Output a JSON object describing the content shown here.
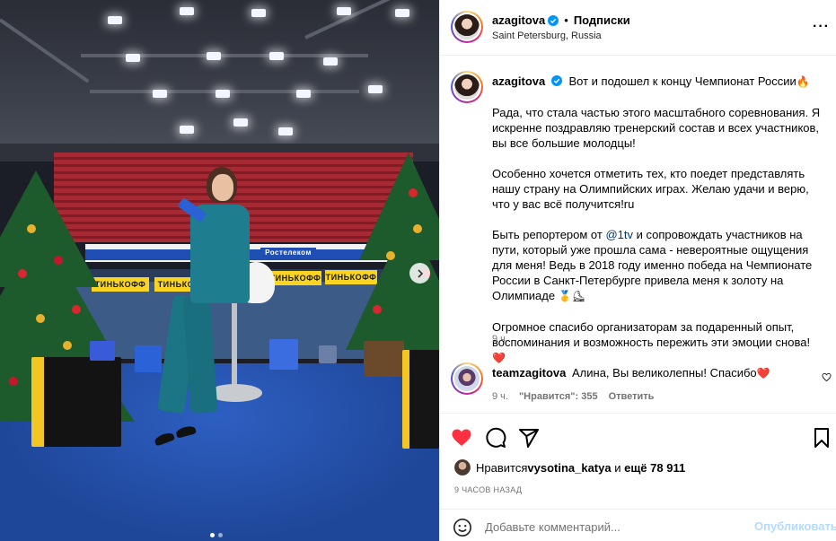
{
  "post": {
    "author": "azagitova",
    "verified": true,
    "follow_label": "Подписки",
    "location": "Saint Petersburg, Russia",
    "more_icon": "more-horizontal-icon",
    "media_pages": 2,
    "media_active_page": 1
  },
  "caption": {
    "author": "azagitova",
    "first_line": "Вот и подошел к концу Чемпионат России",
    "first_line_emoji": "🔥",
    "paragraphs": [
      "Рада, что стала частью этого масштабного соревнования. Я искренне поздравляю тренерский состав и всех участников, вы все большие молодцы!",
      "Особенно хочется отметить тех, кто поедет представлять нашу страну на Олимпийских играх. Желаю удачи и верю, что у вас всё получится!ru"
    ],
    "p3_before": "Быть репортером от ",
    "p3_mention": "@1tv",
    "p3_after": " и сопровождать участников на пути, который уже прошла сама - невероятные ощущения для меня! Ведь в 2018 году именно победа на Чемпионате России в Санкт-Петербурге привела меня к золоту на Олимпиаде ",
    "p3_emoji": "🥇⛸",
    "p4": "Огромное спасибо организаторам за подаренный опыт, воспоминания и возможность пережить эти эмоции снова! ",
    "p4_emoji": "❤️",
    "time": "9 ч."
  },
  "comment": {
    "author": "teamzagitova",
    "text": "Алина, Вы великолепны! Спасибо",
    "emoji": "❤️",
    "time": "9 ч.",
    "likes": "\"Нравится\": 355",
    "reply": "Ответить"
  },
  "actions": {
    "like_icon": "heart-filled-icon",
    "comment_icon": "comment-icon",
    "share_icon": "share-icon",
    "save_icon": "bookmark-icon",
    "liked": true,
    "like_color": "#ff3040"
  },
  "likes": {
    "prefix": "Нравится ",
    "user": "vysotina_katya",
    "middle": " и ",
    "count": "ещё 78 911"
  },
  "posted_ago": "9 ЧАСОВ НАЗАД",
  "add_comment": {
    "placeholder": "Добавьте комментарий...",
    "publish": "Опубликовать"
  },
  "banners": {
    "brand": "ТИНЬКОФФ",
    "sponsor": "Ростелеком"
  },
  "colors": {
    "link": "#00376b",
    "verified": "#0095f6",
    "muted": "#737373",
    "publish_disabled": "#b3dbff"
  }
}
